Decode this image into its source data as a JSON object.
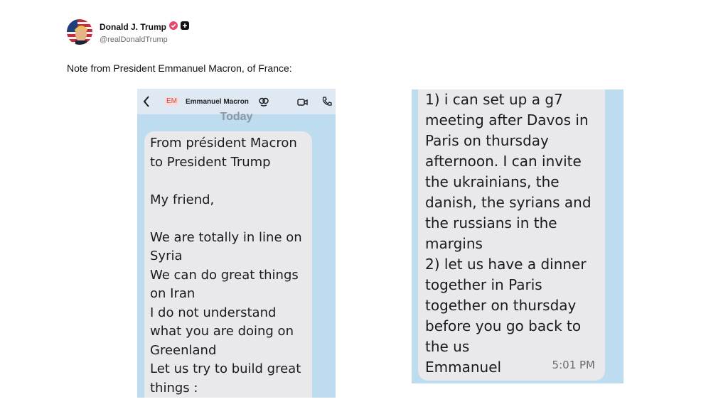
{
  "post": {
    "display_name": "Donald J. Trump",
    "handle": "@realDonaldTrump",
    "text": "Note from President Emmanuel Macron, of France:"
  },
  "icons": {
    "avatar": "flag-portrait-avatar",
    "verified": "verified-badge-icon",
    "plus": "plus-icon",
    "back": "chevron-left-icon",
    "contact": "link-glyph-icon",
    "video": "video-call-icon",
    "phone": "phone-call-icon"
  },
  "colors": {
    "verified_badge": "#e8476b",
    "screenshot_bg": "#bddcf0",
    "bubble": "#e9e9ec"
  },
  "left_screenshot": {
    "contact_initials": "EM",
    "contact_name": "Emmanuel Macron",
    "day_label": "Today",
    "lines": [
      "From président Macron",
      "to President Trump",
      "",
      "My friend,",
      "",
      "We are totally in line on",
      "Syria",
      "We can do great things",
      "on Iran",
      "I do not understand",
      "what you are doing on",
      "Greenland",
      "Let us try to build great",
      "things :"
    ]
  },
  "right_screenshot": {
    "lines": [
      "1) i can set up a g7",
      "meeting after Davos in",
      "Paris on thursday",
      "afternoon. I can invite",
      "the ukrainians, the",
      "danish, the syrians and",
      "the russians in the",
      "margins",
      "2) let us have a dinner",
      "together in Paris",
      "together on thursday",
      "before you go back to",
      "the us",
      "Emmanuel"
    ],
    "timestamp": "5:01 PM"
  }
}
